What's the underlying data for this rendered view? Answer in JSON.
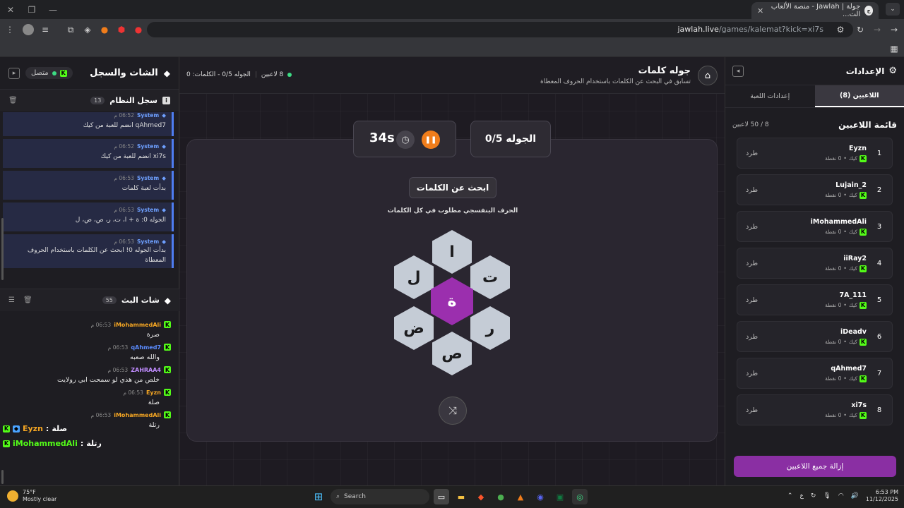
{
  "browser": {
    "tab_title": "جولة | Jawlah - منصة الألعاب الت...",
    "url_host": "jawlah.live",
    "url_path": "/games/kalemat?kick=xi7s"
  },
  "chat": {
    "title": "الشات والسجل",
    "status": "متصل",
    "system_log": {
      "title": "سجل النظام",
      "count": "13",
      "messages": [
        {
          "name": "System",
          "time": "06:52 م",
          "text": "qAhmed7 انضم للعبة من كيك"
        },
        {
          "name": "System",
          "time": "06:52 م",
          "text": "xi7s انضم للعبة من كيك"
        },
        {
          "name": "System",
          "time": "06:53 م",
          "text": "بدأت لعبة كلمات"
        },
        {
          "name": "System",
          "time": "06:53 م",
          "text": "الجوله 0: ة + ا، ت، ر، ص، ض، ل"
        },
        {
          "name": "System",
          "time": "06:53 م",
          "text": "بدأت الجوله 0! ابحث عن الكلمات باستخدام الحروف المعطاة"
        }
      ]
    },
    "live_chat": {
      "title": "شات البث",
      "count": "55",
      "messages": [
        {
          "name": "iMohammedAli",
          "color": "#f5a623",
          "time": "06:53 م",
          "text": "صرة"
        },
        {
          "name": "qAhmed7",
          "color": "#5b8cff",
          "time": "06:53 م",
          "text": "والله صعبه"
        },
        {
          "name": "ZAHRAA4",
          "color": "#c08cff",
          "time": "06:53 م",
          "text": "خلص من هذي لو سمحت ابي رولايت"
        },
        {
          "name": "Eyzn",
          "color": "#f5a623",
          "time": "06:53 م",
          "text": "صلة"
        },
        {
          "name": "iMohammedAli",
          "color": "#f5a623",
          "time": "06:53 م",
          "text": "رتلة"
        }
      ],
      "overlay": [
        {
          "name": "Eyzn",
          "word": "صلة"
        },
        {
          "name": "iMohammedAli",
          "word": "رتلة"
        }
      ]
    }
  },
  "game": {
    "title": "جوله كلمات",
    "subtitle": "تسابق في البحث عن الكلمات باستخدام الحروف المعطاة",
    "players_count": "8 لاعبين",
    "status_round": "الجوله 0/5 - الكلمات: 0",
    "timer": "34s",
    "round_label": "الجوله 0/5",
    "task_title": "ابحث عن الكلمات",
    "task_sub": "الحرف البنفسجي مطلوب في كل الكلمات",
    "letters": {
      "center": "ة",
      "top": "ا",
      "top_right": "ت",
      "bottom_right": "ر",
      "bottom": "ص",
      "bottom_left": "ض",
      "top_left": "ل"
    }
  },
  "settings": {
    "title": "الإعدادات",
    "tab_players": "اللاعبين (8)",
    "tab_game": "إعدادات اللعبة",
    "players_title": "قائمة اللاعبين",
    "capacity": "8 / 50 لاعبين",
    "kick_label": "طرد",
    "platform": "كيك",
    "points": "0 نقطة",
    "players": [
      {
        "rank": "1",
        "name": "Eyzn"
      },
      {
        "rank": "2",
        "name": "Lujain_2"
      },
      {
        "rank": "3",
        "name": "iMohammedAli"
      },
      {
        "rank": "4",
        "name": "iiRay2"
      },
      {
        "rank": "5",
        "name": "7A_111"
      },
      {
        "rank": "6",
        "name": "iDeadv"
      },
      {
        "rank": "7",
        "name": "qAhmed7"
      },
      {
        "rank": "8",
        "name": "xi7s"
      }
    ],
    "remove_all": "إزالة جميع اللاعبين"
  },
  "taskbar": {
    "temp": "75°F",
    "weather": "Mostly clear",
    "search": "Search",
    "time": "6:53 PM",
    "date": "11/12/2025",
    "lang": "ع"
  }
}
